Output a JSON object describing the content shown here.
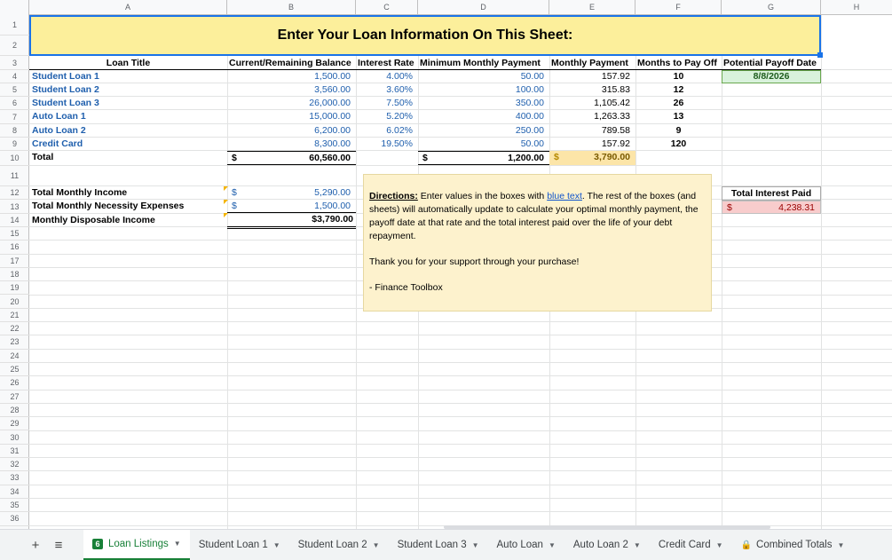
{
  "columns": [
    "A",
    "B",
    "C",
    "D",
    "E",
    "F",
    "G",
    "H"
  ],
  "rows": [
    "1",
    "2",
    "3",
    "4",
    "5",
    "6",
    "7",
    "8",
    "9",
    "10",
    "11",
    "12",
    "13",
    "14",
    "15",
    "16",
    "17",
    "18",
    "19",
    "20",
    "21",
    "22",
    "23",
    "24",
    "25",
    "26",
    "27",
    "28",
    "29",
    "30",
    "31",
    "32",
    "33",
    "34",
    "35",
    "36"
  ],
  "banner": "Enter Your Loan Information On This Sheet:",
  "headers": {
    "loan_title": "Loan Title",
    "balance": "Current/Remaining Balance",
    "rate": "Interest Rate",
    "min_payment": "Minimum Monthly Payment",
    "monthly_payment": "Monthly Payment",
    "months": "Months to Pay Off",
    "payoff_date": "Potential Payoff Date"
  },
  "loans": [
    {
      "title": "Student Loan 1",
      "balance": "1,500.00",
      "rate": "4.00%",
      "min": "50.00",
      "monthly": "157.92",
      "months": "10"
    },
    {
      "title": "Student Loan 2",
      "balance": "3,560.00",
      "rate": "3.60%",
      "min": "100.00",
      "monthly": "315.83",
      "months": "12"
    },
    {
      "title": "Student Loan 3",
      "balance": "26,000.00",
      "rate": "7.50%",
      "min": "350.00",
      "monthly": "1,105.42",
      "months": "26"
    },
    {
      "title": "Auto Loan 1",
      "balance": "15,000.00",
      "rate": "5.20%",
      "min": "400.00",
      "monthly": "1,263.33",
      "months": "13"
    },
    {
      "title": "Auto Loan 2",
      "balance": "6,200.00",
      "rate": "6.02%",
      "min": "250.00",
      "monthly": "789.58",
      "months": "9"
    },
    {
      "title": "Credit Card",
      "balance": "8,300.00",
      "rate": "19.50%",
      "min": "50.00",
      "monthly": "157.92",
      "months": "120"
    }
  ],
  "payoff_date": "8/8/2026",
  "totals": {
    "label": "Total",
    "currency": "$",
    "balance": "60,560.00",
    "min": "1,200.00",
    "monthly": "3,790.00"
  },
  "income": {
    "income_label": "Total Monthly Income",
    "income_value": "5,290.00",
    "expenses_label": "Total Monthly Necessity Expenses",
    "expenses_value": "1,500.00",
    "disposable_label": "Monthly Disposable Income",
    "disposable_value": "$3,790.00",
    "currency": "$"
  },
  "interest": {
    "label": "Total Interest Paid",
    "currency": "$",
    "value": "4,238.31"
  },
  "directions": {
    "label": "Directions:",
    "text1": " Enter values in the boxes with ",
    "link": "blue text",
    "text2": ". The rest of the boxes (and sheets) will automatically update to calculate your optimal monthly payment, the payoff date at that rate and the total interest paid over the life of your debt repayment.",
    "thanks": "Thank you for your support through your purchase!",
    "signature": "- Finance Toolbox"
  },
  "tabs": {
    "add": "+",
    "all_sheets": "≡",
    "active_badge": "6",
    "items": [
      "Loan Listings",
      "Student Loan 1",
      "Student Loan 2",
      "Student Loan 3",
      "Auto Loan",
      "Auto Loan 2",
      "Credit Card",
      "Combined Totals"
    ]
  },
  "colors": {
    "banner": "#fcef9b",
    "blue_text": "#1f5fad",
    "active_tab": "#188038"
  }
}
